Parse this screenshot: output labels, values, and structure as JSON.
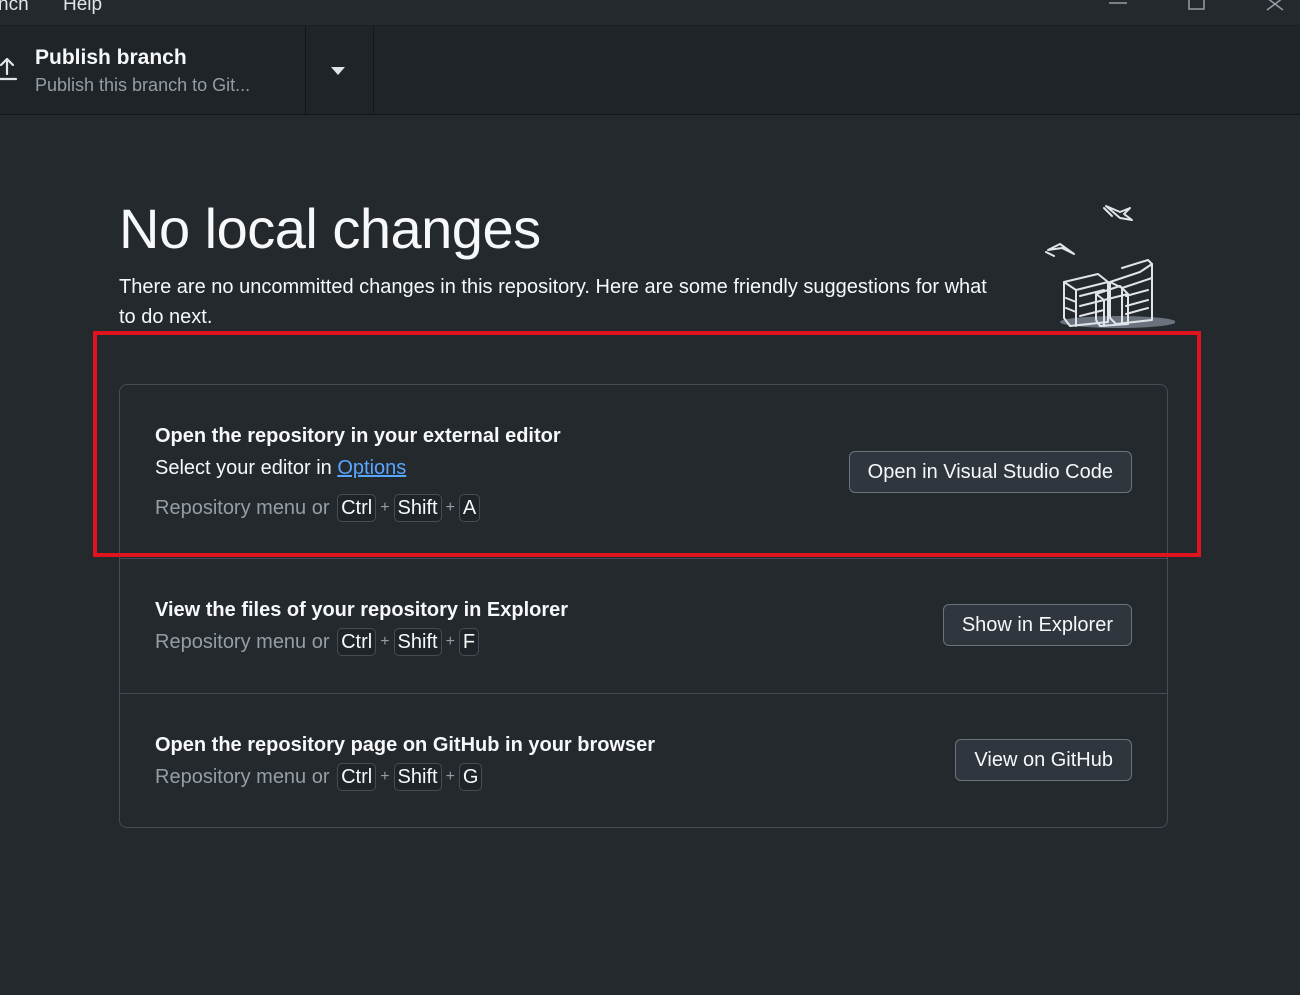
{
  "menu": {
    "items": [
      "nch",
      "Help"
    ]
  },
  "toolbar": {
    "publish_title": "Publish branch",
    "publish_subtitle": "Publish this branch to Git..."
  },
  "blankslate": {
    "heading": "No local changes",
    "description": "There are no uncommitted changes in this repository. Here are some friendly suggestions for what to do next."
  },
  "actions": [
    {
      "title": "Open the repository in your external editor",
      "desc_prefix": "Select your editor in ",
      "desc_link": "Options",
      "shortcut_prefix": "Repository menu or",
      "keys": [
        "Ctrl",
        "Shift",
        "A"
      ],
      "button": "Open in Visual Studio Code"
    },
    {
      "title": "View the files of your repository in Explorer",
      "shortcut_prefix": "Repository menu or",
      "keys": [
        "Ctrl",
        "Shift",
        "F"
      ],
      "button": "Show in Explorer"
    },
    {
      "title": "Open the repository page on GitHub in your browser",
      "shortcut_prefix": "Repository menu or",
      "keys": [
        "Ctrl",
        "Shift",
        "G"
      ],
      "button": "View on GitHub"
    }
  ],
  "plus_sign": "+",
  "colors": {
    "background": "#24292e",
    "link": "#58a6ff",
    "highlight": "#e0141e"
  },
  "icons": [
    "upload-icon",
    "caret-down-icon",
    "minimize-icon",
    "maximize-icon",
    "close-icon",
    "empty-repo-illustration"
  ]
}
